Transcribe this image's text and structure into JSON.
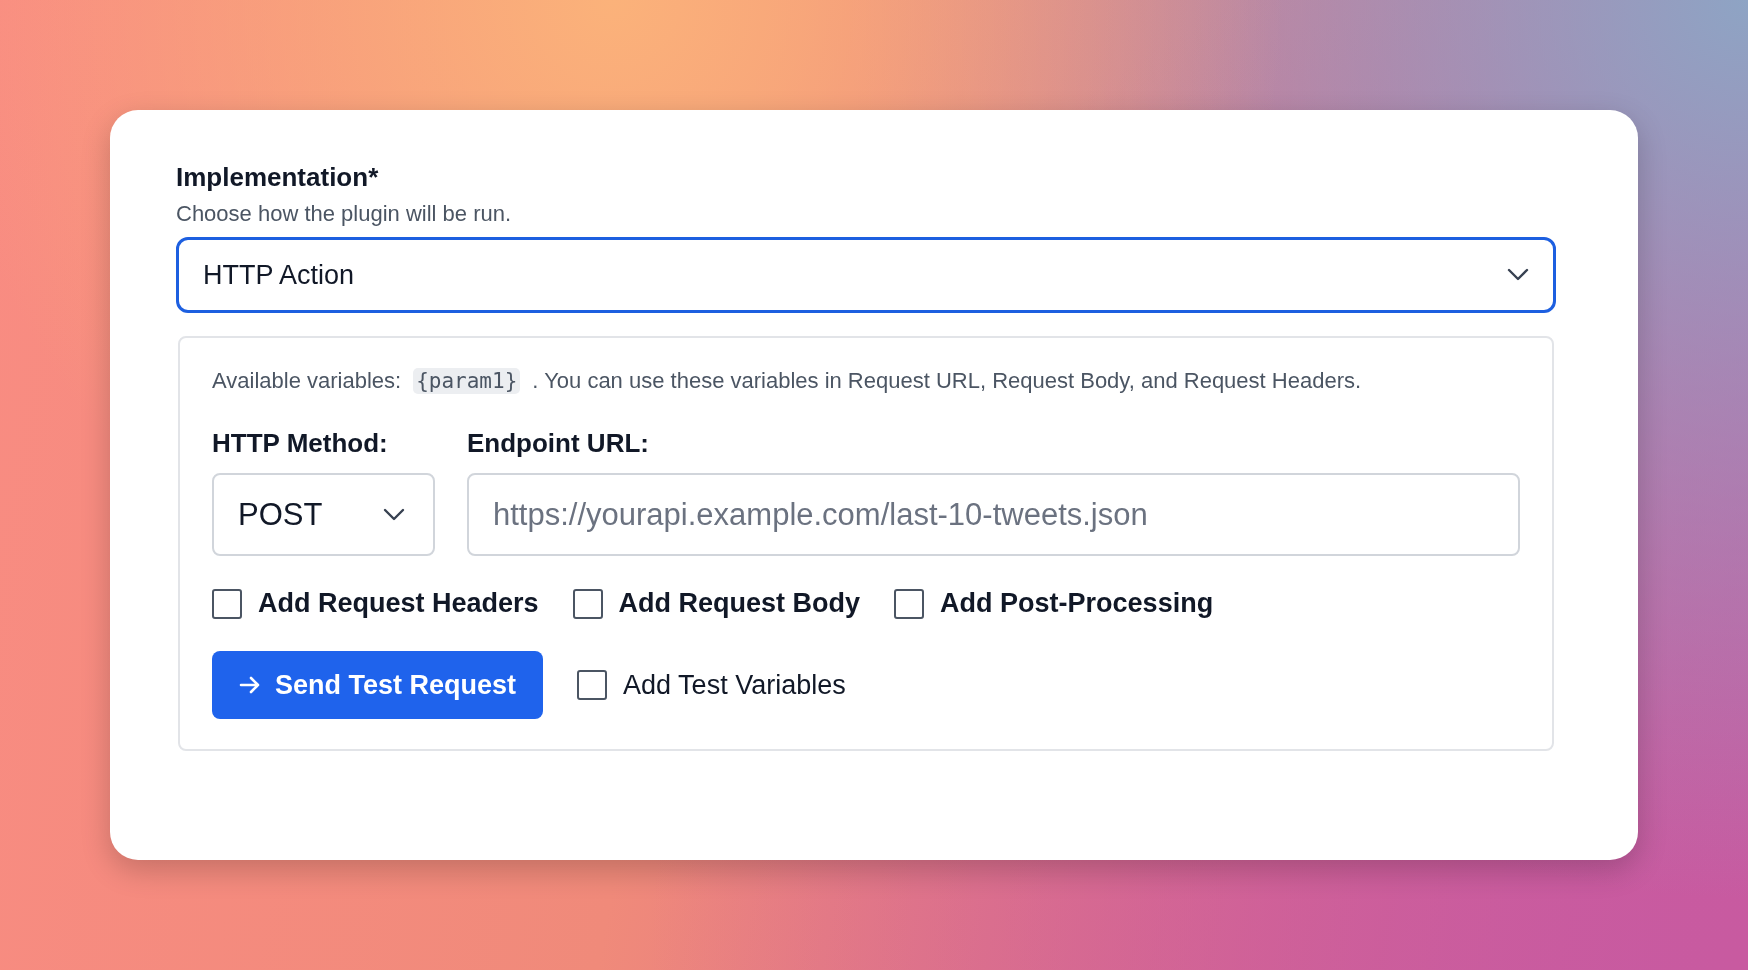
{
  "implementation": {
    "label": "Implementation*",
    "hint": "Choose how the plugin will be run.",
    "value": "HTTP Action"
  },
  "http_action": {
    "variables_text": "Available variables:",
    "variable": "{param1}",
    "variables_note": ". You can use these variables in Request URL, Request Body, and Request Headers.",
    "method": {
      "label": "HTTP Method:",
      "value": "POST"
    },
    "endpoint": {
      "label": "Endpoint URL:",
      "placeholder": "https://yourapi.example.com/last-10-tweets.json"
    },
    "options": [
      {
        "label": "Add Request Headers",
        "checked": false
      },
      {
        "label": "Add Request Body",
        "checked": false
      },
      {
        "label": "Add Post-Processing",
        "checked": false
      }
    ],
    "send_button": "Send Test Request",
    "test_variables": {
      "label": "Add Test Variables",
      "checked": false
    }
  }
}
